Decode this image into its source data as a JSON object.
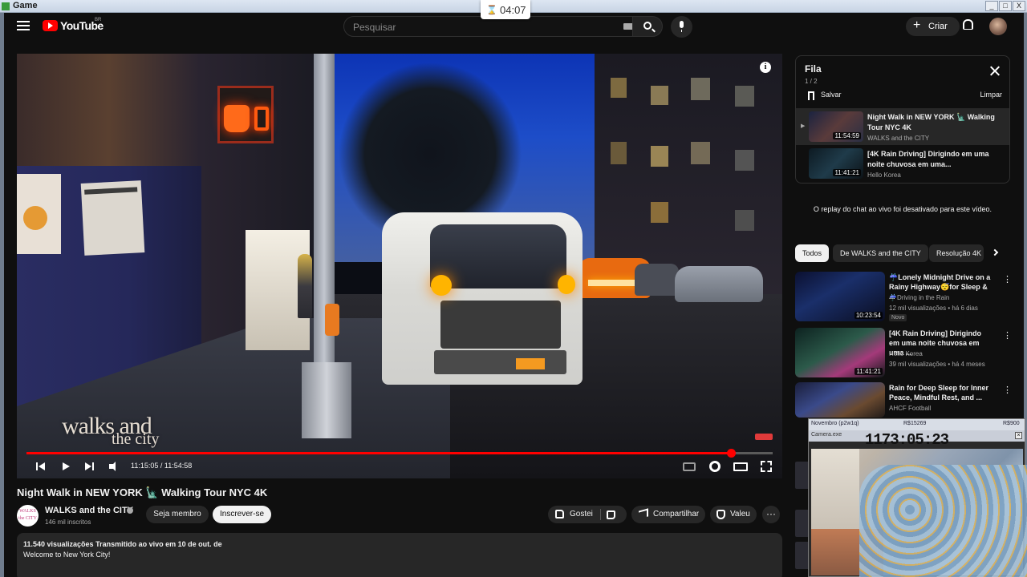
{
  "window": {
    "title": "Game",
    "buttons": [
      "_",
      "□",
      "X"
    ]
  },
  "timer": {
    "icon": "hourglass-icon",
    "value": "04:07"
  },
  "masthead": {
    "logo_text": "YouTube",
    "country": "BR",
    "search_placeholder": "Pesquisar",
    "create_label": "Criar"
  },
  "player": {
    "watermark_line1": "walks and",
    "watermark_line2": "the city",
    "time_display": "11:15:05 / 11:54:58",
    "progress_fraction": 0.9445
  },
  "video": {
    "title": "Night Walk in NEW YORK 🗽 Walking Tour NYC 4K",
    "channel_avatar_text": "WALKS the CITY",
    "channel_name": "WALKS and the CITY",
    "subscribers": "146 mil inscritos",
    "join_label": "Seja membro",
    "subscribe_label": "Inscrever-se",
    "like_label": "Gostei",
    "share_label": "Compartilhar",
    "thanks_label": "Valeu",
    "more_label": "···",
    "desc_line1": "11.540 visualizações  Transmitido ao vivo em 10 de out. de",
    "desc_line2": "Welcome to New York City!"
  },
  "queue": {
    "title": "Fila",
    "count": "1 / 2",
    "save_label": "Salvar",
    "clear_label": "Limpar",
    "items": [
      {
        "title": "Night Walk in NEW YORK 🗽 Walking Tour NYC 4K",
        "channel": "WALKS and the CITY",
        "duration": "11:54:59"
      },
      {
        "title": "[4K Rain Driving] Dirigindo em uma noite chuvosa em uma...",
        "channel": "Hello Korea",
        "duration": "11:41:21"
      }
    ]
  },
  "chat_message": "O replay do chat ao vivo foi desativado para este vídeo.",
  "chips": [
    "Todos",
    "De WALKS and the CITY",
    "Resolução 4K"
  ],
  "recommendations": [
    {
      "title": "☔Lonely Midnight Drive on a Rainy Highway😴for Sleep & ...",
      "channel": "☔Driving in the Rain",
      "views": "12 mil visualizações • há 6 dias",
      "duration": "10:23:54",
      "badge": "Novo"
    },
    {
      "title": "[4K Rain Driving] Dirigindo em uma noite chuvosa em uma ...",
      "channel": "Hello Korea",
      "views": "39 mil visualizações • há 4 meses",
      "duration": "11:41:21",
      "badge": ""
    },
    {
      "title": "Rain for Deep Sleep for Inner Peace, Mindful Rest, and ...",
      "channel": "AHCF Football",
      "views": "",
      "duration": "",
      "badge": ""
    }
  ],
  "camera": {
    "header_left": "Novembro (p2w1q)",
    "header_mid": "R$15269",
    "header_right": "R$900",
    "subheader": "Camera.exe",
    "counter": "1173:05:23"
  }
}
